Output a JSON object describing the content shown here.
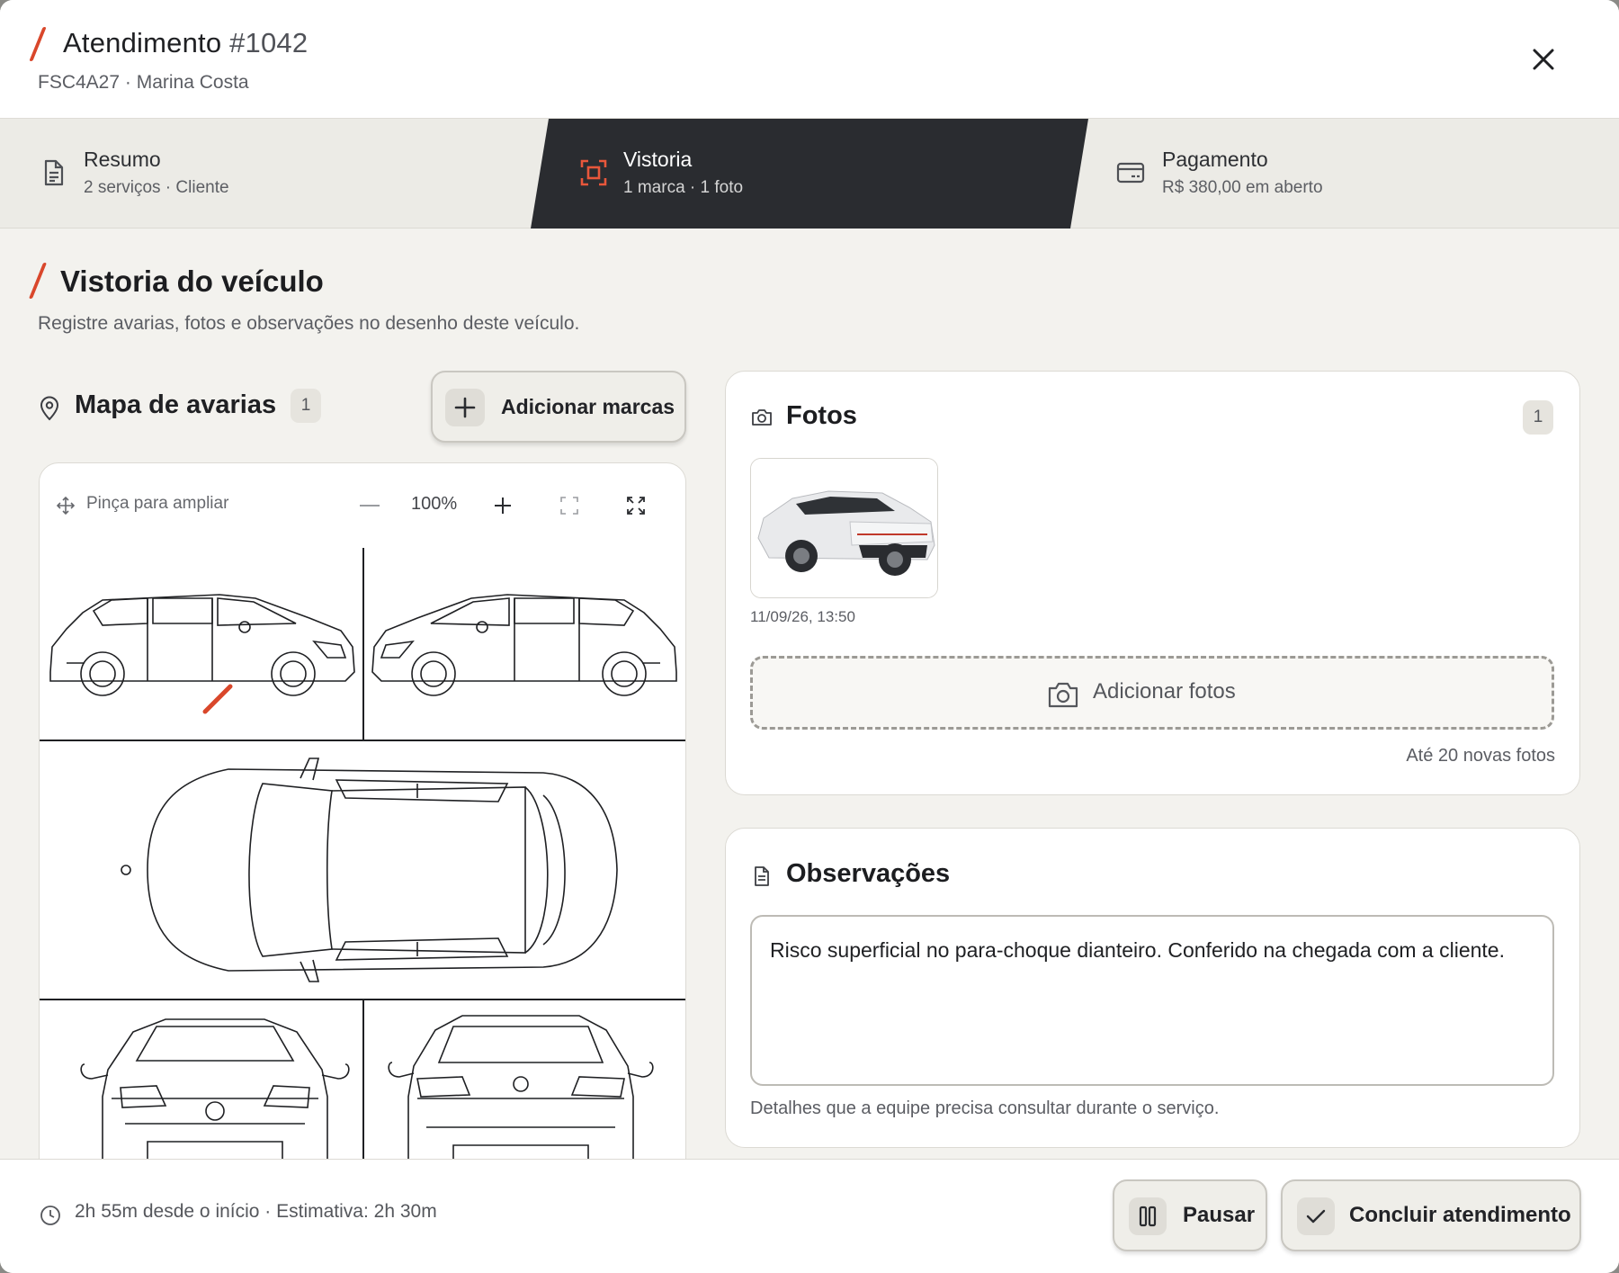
{
  "header": {
    "title": "Atendimento",
    "number": "#1042",
    "subtitle": "FSC4A27 · Marina Costa"
  },
  "tabs": [
    {
      "title": "Resumo",
      "subtitle": "2 serviços · Cliente",
      "icon": "document-icon",
      "active": false
    },
    {
      "title": "Vistoria",
      "subtitle": "1 marca · 1 foto",
      "icon": "scan-icon",
      "active": true
    },
    {
      "title": "Pagamento",
      "subtitle": "R$ 380,00 em aberto",
      "icon": "card-icon",
      "active": false
    }
  ],
  "section": {
    "title": "Vistoria do veículo",
    "subtitle": "Registre avarias, fotos e observações no desenho deste veículo."
  },
  "map": {
    "title": "Mapa de avarias",
    "count": "1",
    "add_label": "Adicionar marcas",
    "pinch_label": "Pinça para ampliar",
    "zoom": "100%"
  },
  "photos": {
    "title": "Fotos",
    "count": "1",
    "items": [
      {
        "timestamp": "11/09/26, 13:50"
      }
    ],
    "add_label": "Adicionar fotos",
    "limit": "Até 20 novas fotos"
  },
  "notes": {
    "title": "Observações",
    "text": "Risco superficial no para-choque dianteiro. Conferido na chegada com a cliente.",
    "help": "Detalhes que a equipe precisa consultar durante o serviço."
  },
  "footer": {
    "time_text": "2h 55m desde o início  · Estimativa: 2h 30m",
    "pause_label": "Pausar",
    "finish_label": "Concluir  atendimento"
  },
  "colors": {
    "accent": "#d9472b",
    "active_tab": "#2a2c30",
    "background": "#f3f2ee"
  }
}
